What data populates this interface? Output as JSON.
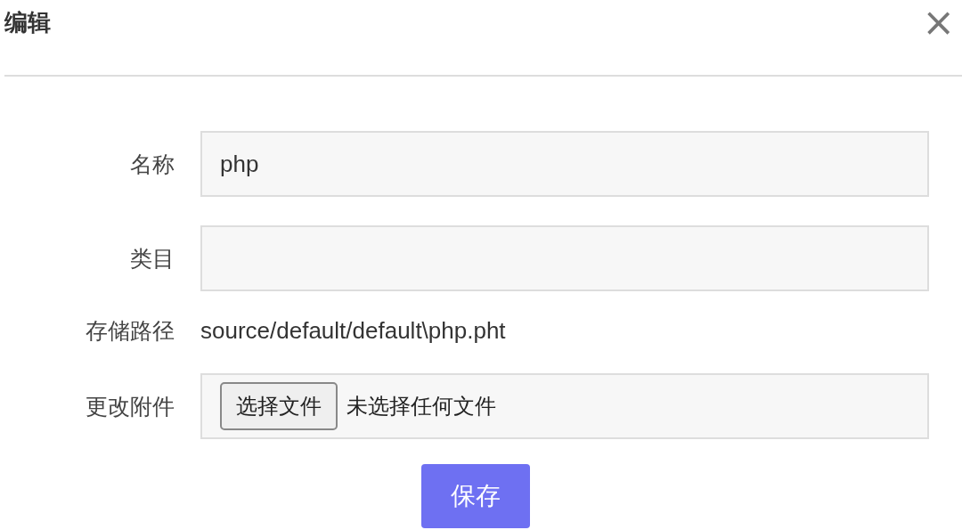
{
  "dialog": {
    "title": "编辑",
    "close": "×"
  },
  "form": {
    "fields": [
      {
        "kind": "input",
        "label": "名称",
        "value": "php"
      },
      {
        "kind": "input",
        "label": "类目"
      },
      {
        "kind": "text",
        "label": "存储路径",
        "value": "source/default/default\\php.pht"
      },
      {
        "kind": "file",
        "label": "更改附件",
        "button": "选择文件",
        "status": "未选择任何文件"
      }
    ],
    "submit": "保存"
  }
}
